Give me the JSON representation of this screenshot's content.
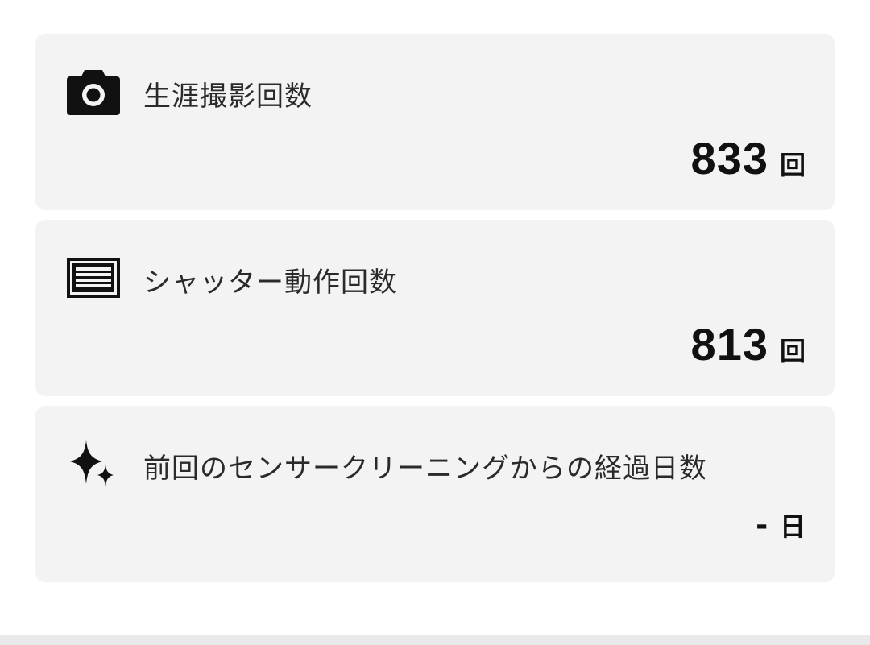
{
  "stats": [
    {
      "icon": "camera-icon",
      "label": "生涯撮影回数",
      "value": "833",
      "unit": "回"
    },
    {
      "icon": "shutter-icon",
      "label": "シャッター動作回数",
      "value": "813",
      "unit": "回"
    },
    {
      "icon": "sparkle-icon",
      "label": "前回のセンサークリーニングからの経過日数",
      "value": "-",
      "unit": "日"
    }
  ],
  "colors": {
    "card_background": "#f3f3f3",
    "page_background": "#ffffff",
    "text": "#1a1a1a"
  }
}
